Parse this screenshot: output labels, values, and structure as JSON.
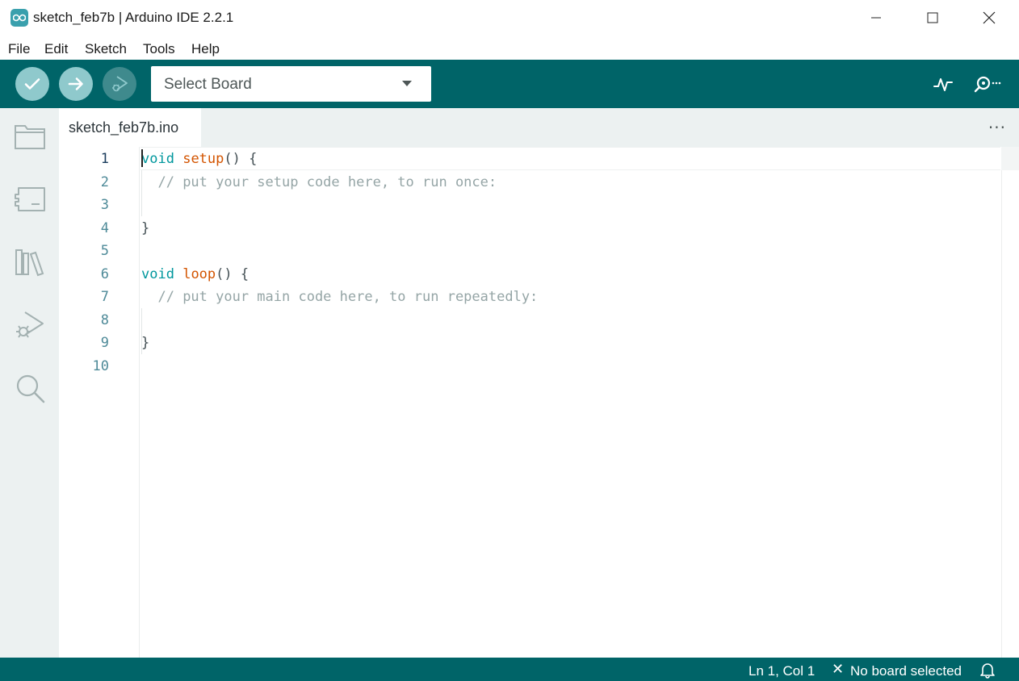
{
  "window": {
    "title": "sketch_feb7b | Arduino IDE 2.2.1",
    "app_icon": "arduino-infinity-icon",
    "controls": [
      "minimize-icon",
      "maximize-icon",
      "close-icon"
    ]
  },
  "menu": {
    "items": [
      "File",
      "Edit",
      "Sketch",
      "Tools",
      "Help"
    ]
  },
  "toolbar": {
    "verify_icon": "checkmark-icon",
    "upload_icon": "arrow-right-icon",
    "debug_icon": "debug-play-icon",
    "board_select_label": "Select Board",
    "serial_plotter_icon": "pulse-icon",
    "serial_monitor_icon": "magnifier-dots-icon"
  },
  "sidebar": {
    "items": [
      {
        "name": "sketchbook",
        "icon": "folder-icon"
      },
      {
        "name": "boards-manager",
        "icon": "board-icon"
      },
      {
        "name": "library-manager",
        "icon": "books-icon"
      },
      {
        "name": "debug",
        "icon": "debug-icon"
      },
      {
        "name": "search",
        "icon": "search-icon"
      }
    ]
  },
  "tabs": {
    "active": "sketch_feb7b.ino",
    "more_label": "···"
  },
  "editor": {
    "lines": [
      {
        "num": "1",
        "kw": "void",
        "fn": "setup",
        "rest": "() {",
        "cm": ""
      },
      {
        "num": "2",
        "kw": "",
        "fn": "",
        "rest": "  ",
        "cm": "// put your setup code here, to run once:"
      },
      {
        "num": "3",
        "kw": "",
        "fn": "",
        "rest": "",
        "cm": ""
      },
      {
        "num": "4",
        "kw": "",
        "fn": "",
        "rest": "}",
        "cm": ""
      },
      {
        "num": "5",
        "kw": "",
        "fn": "",
        "rest": "",
        "cm": ""
      },
      {
        "num": "6",
        "kw": "void",
        "fn": "loop",
        "rest": "() {",
        "cm": ""
      },
      {
        "num": "7",
        "kw": "",
        "fn": "",
        "rest": "  ",
        "cm": "// put your main code here, to run repeatedly:"
      },
      {
        "num": "8",
        "kw": "",
        "fn": "",
        "rest": "",
        "cm": ""
      },
      {
        "num": "9",
        "kw": "",
        "fn": "",
        "rest": "}",
        "cm": ""
      },
      {
        "num": "10",
        "kw": "",
        "fn": "",
        "rest": "",
        "cm": ""
      }
    ]
  },
  "status": {
    "position": "Ln 1, Col 1",
    "board_icon": "x-icon",
    "board": "No board selected",
    "notifications_icon": "bell-icon"
  },
  "colors": {
    "teal": "#006468",
    "button_light": "#8fc9cc",
    "keyword": "#00979d",
    "function": "#d35400",
    "comment": "#95a5a6"
  }
}
